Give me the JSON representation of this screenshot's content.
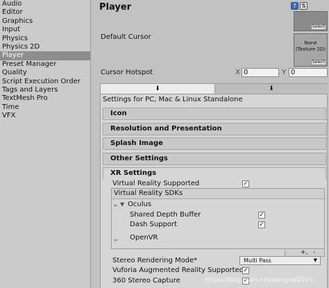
{
  "sidebar": {
    "items": [
      "Audio",
      "Editor",
      "Graphics",
      "Input",
      "Physics",
      "Physics 2D",
      "Player",
      "Preset Manager",
      "Quality",
      "Script Execution Order",
      "Tags and Layers",
      "TextMesh Pro",
      "Time",
      "VFX"
    ],
    "selected_index": 6
  },
  "header": {
    "title": "Player",
    "help_icon": "help-book-icon",
    "settings_icon": "settings-sliders-icon"
  },
  "cursor": {
    "default_cursor_label": "Default Cursor",
    "select_label": "Select",
    "none_texture_text": "None\n(Texture 2D)",
    "hotspot_label": "Cursor Hotspot",
    "x_label": "X",
    "x_value": "0",
    "y_label": "Y",
    "y_value": "0"
  },
  "platform": {
    "tabs": [
      "standalone-download-icon",
      "android-robot-icon"
    ],
    "settings_title": "Settings for PC, Mac & Linux Standalone"
  },
  "sections": [
    "Icon",
    "Resolution and Presentation",
    "Splash Image",
    "Other Settings",
    "XR Settings"
  ],
  "xr": {
    "vr_supported_label": "Virtual Reality Supported",
    "vr_supported": true,
    "sdks_header": "Virtual Reality SDKs",
    "oculus_label": "Oculus",
    "shared_depth_label": "Shared Depth Buffer",
    "shared_depth": true,
    "dash_support_label": "Dash Support",
    "dash_support": true,
    "openvr_label": "OpenVR",
    "add_symbol": "+,",
    "remove_symbol": "-",
    "stereo_mode_label": "Stereo Rendering Mode*",
    "stereo_mode_value": "Multi Pass",
    "vuforia_label": "Vuforia Augmented Reality Supported",
    "vuforia": true,
    "stereo360_label": "360 Stereo Capture",
    "stereo360": true
  },
  "watermark": "https://blog.csdn.net/wangzw2020",
  "colors": {
    "selected_bg": "#8e8e8e",
    "panel_bg": "#d6d6d6",
    "window_bg": "#c2c2c2"
  }
}
